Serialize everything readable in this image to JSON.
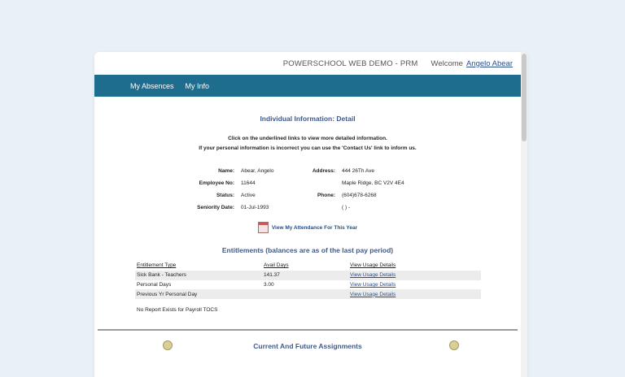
{
  "header": {
    "app_title": "POWERSCHOOL WEB DEMO - PRM",
    "welcome_label": "Welcome",
    "user_name": "Angelo Abear"
  },
  "nav": {
    "items": [
      {
        "label": "My Absences"
      },
      {
        "label": "My Info"
      }
    ]
  },
  "info": {
    "title": "Individual Information: Detail",
    "instruction_line1": "Click on the underlined links to view more detailed information.",
    "instruction_line2": "If your personal information is incorrect you can use the 'Contact Us' link to inform us.",
    "labels": {
      "name": "Name:",
      "employee_no": "Employee No:",
      "status": "Status:",
      "seniority": "Seniority Date:",
      "address": "Address:",
      "phone": "Phone:"
    },
    "values": {
      "name": "Abear, Angelo",
      "employee_no": "11644",
      "status": "Active",
      "seniority": "01-Jul-1993",
      "address_line1": "444 26Th Ave",
      "address_line2": "Maple Ridge, BC V2V 4E4",
      "phone": "(604)678-6268",
      "phone2": "( ) -"
    },
    "attendance_link": "View My Attendance For This Year"
  },
  "entitlements": {
    "title": "Entitlements (balances are as of the last pay period)",
    "headers": [
      "Entitlement Type",
      "Avail Days",
      "View Usage Details"
    ],
    "rows": [
      {
        "type": "Sick Bank - Teachers",
        "days": "141.37",
        "link": "View Usage Details"
      },
      {
        "type": "Personal Days",
        "days": "3.00",
        "link": "View Usage Details"
      },
      {
        "type": "Previous Yr Personal Day",
        "days": "",
        "link": "View Usage Details"
      }
    ],
    "no_report": "No Report Exists for Payroll TOCS"
  },
  "assignments": {
    "title": "Current And Future Assignments"
  },
  "colors": {
    "nav_bg": "#1f6d8e",
    "link": "#2a4f8a",
    "heading": "#3f5a8a",
    "page_bg": "#e9f1f6"
  }
}
